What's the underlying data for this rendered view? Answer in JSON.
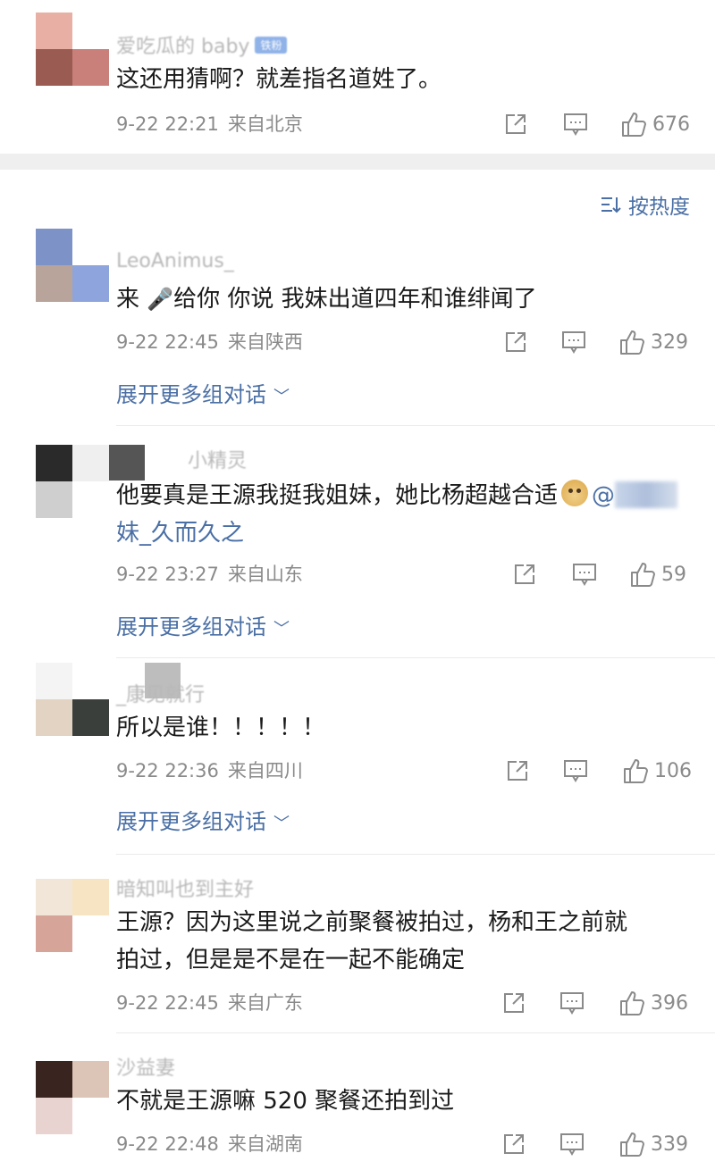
{
  "sort": {
    "label": "按热度"
  },
  "comments": [
    {
      "username": "爱吃瓜的 baby",
      "badge": "铁粉",
      "text": "这还用猜啊？就差指名道姓了。",
      "date": "9-22 22:21",
      "location": "来自北京",
      "likes": "676"
    },
    {
      "username": "LeoAnimus_",
      "text_before": "来 ",
      "text_emoji": "🎤",
      "text_after": "给你 你说 我妹出道四年和谁绯闻了",
      "date": "9-22 22:45",
      "location": "来自陕西",
      "likes": "329",
      "expand": "展开更多组对话"
    },
    {
      "username": "小精灵",
      "text_line1": "他要真是王源我挺我姐妹，她比杨超越合适",
      "mention_prefix": "@",
      "text_line2": "妹_久而久之",
      "date": "9-22 23:27",
      "location": "来自山东",
      "likes": "59",
      "expand": "展开更多组对话"
    },
    {
      "username": "_康见就行",
      "text": "所以是谁！！！！！",
      "date": "9-22 22:36",
      "location": "来自四川",
      "likes": "106",
      "expand": "展开更多组对话"
    },
    {
      "username": "暗知叫也到主好",
      "text_line1": "王源？因为这里说之前聚餐被拍过，杨和王之前就",
      "text_line2": "拍过，但是是不是在一起不能确定",
      "date": "9-22 22:45",
      "location": "来自广东",
      "likes": "396"
    },
    {
      "username": "沙益妻",
      "text": "不就是王源嘛 520 聚餐还拍到过",
      "date": "9-22 22:48",
      "location": "来自湖南",
      "likes": "339"
    }
  ],
  "colors": {
    "link": "#4a6fa5",
    "meta": "#8a8a8a",
    "band": "#efefef"
  },
  "icons": [
    "repost-icon",
    "comment-icon",
    "like-icon",
    "sort-icon",
    "chevron-down-icon"
  ]
}
